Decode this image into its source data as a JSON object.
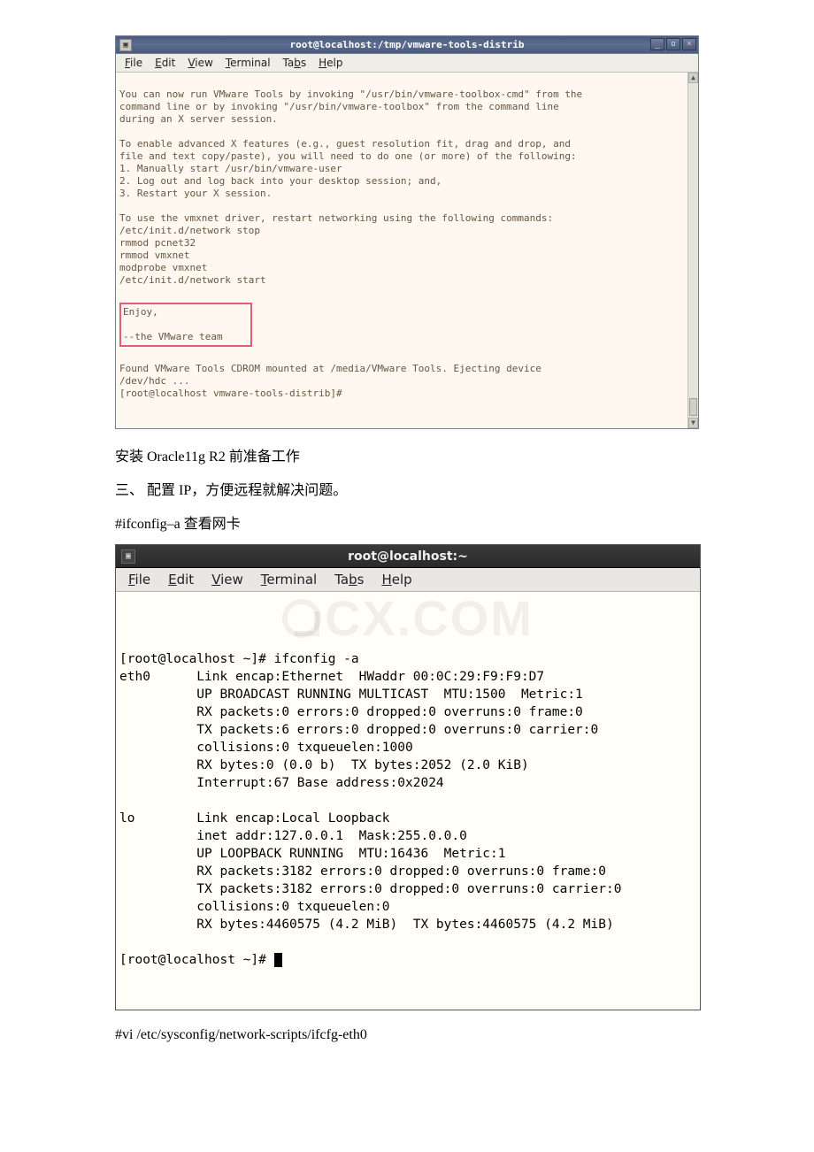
{
  "terminal1": {
    "title": "root@localhost:/tmp/vmware-tools-distrib",
    "menu": {
      "file": "File",
      "edit": "Edit",
      "view": "View",
      "terminal": "Terminal",
      "tabs": "Tabs",
      "help": "Help"
    },
    "pre_text": "You can now run VMware Tools by invoking \"/usr/bin/vmware-toolbox-cmd\" from the\ncommand line or by invoking \"/usr/bin/vmware-toolbox\" from the command line\nduring an X server session.\n\nTo enable advanced X features (e.g., guest resolution fit, drag and drop, and\nfile and text copy/paste), you will need to do one (or more) of the following:\n1. Manually start /usr/bin/vmware-user\n2. Log out and log back into your desktop session; and,\n3. Restart your X session.\n\nTo use the vmxnet driver, restart networking using the following commands:\n/etc/init.d/network stop\nrmmod pcnet32\nrmmod vmxnet\nmodprobe vmxnet\n/etc/init.d/network start",
    "hilite_block": "Enjoy,\n\n--the VMware team",
    "post_text": "Found VMware Tools CDROM mounted at /media/VMware Tools. Ejecting device\n/dev/hdc ...\n[root@localhost vmware-tools-distrib]#"
  },
  "doc": {
    "p1": "安装 Oracle11g R2 前准备工作",
    "p2": "三、 配置 IP，方便远程就解决问题。",
    "p3": "#ifconfig–a 查看网卡",
    "p4": "#vi /etc/sysconfig/network-scripts/ifcfg-eth0"
  },
  "terminal2": {
    "title": "root@localhost:~",
    "menu": {
      "file": "File",
      "edit": "Edit",
      "view": "View",
      "terminal": "Terminal",
      "tabs": "Tabs",
      "help": "Help"
    },
    "watermark": "CX.COM",
    "content": "[root@localhost ~]# ifconfig -a\neth0      Link encap:Ethernet  HWaddr 00:0C:29:F9:F9:D7\n          UP BROADCAST RUNNING MULTICAST  MTU:1500  Metric:1\n          RX packets:0 errors:0 dropped:0 overruns:0 frame:0\n          TX packets:6 errors:0 dropped:0 overruns:0 carrier:0\n          collisions:0 txqueuelen:1000\n          RX bytes:0 (0.0 b)  TX bytes:2052 (2.0 KiB)\n          Interrupt:67 Base address:0x2024\n\nlo        Link encap:Local Loopback\n          inet addr:127.0.0.1  Mask:255.0.0.0\n          UP LOOPBACK RUNNING  MTU:16436  Metric:1\n          RX packets:3182 errors:0 dropped:0 overruns:0 frame:0\n          TX packets:3182 errors:0 dropped:0 overruns:0 carrier:0\n          collisions:0 txqueuelen:0\n          RX bytes:4460575 (4.2 MiB)  TX bytes:4460575 (4.2 MiB)\n\n[root@localhost ~]# "
  }
}
